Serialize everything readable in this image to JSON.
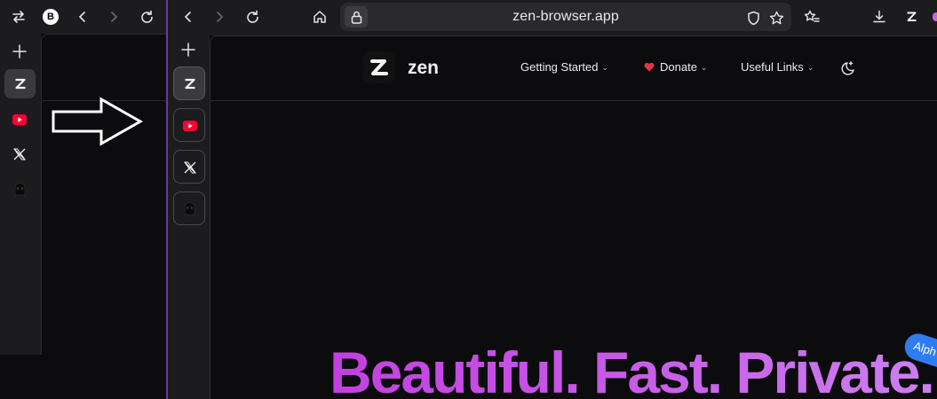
{
  "left_window": {
    "toolbar": {
      "sidebar_toggle_icon": "swap-arrows-icon",
      "profile_badge": "B",
      "back_icon": "chevron-left-icon",
      "forward_icon": "chevron-right-icon",
      "reload_icon": "reload-icon"
    },
    "sidebar": {
      "new_tab_icon": "plus-icon",
      "tabs": [
        {
          "name": "zen",
          "icon": "zen-logo-icon"
        },
        {
          "name": "youtube",
          "icon": "youtube-icon"
        },
        {
          "name": "x",
          "icon": "x-logo-icon"
        },
        {
          "name": "other",
          "icon": "mascot-icon"
        }
      ]
    }
  },
  "arrow": {
    "icon": "right-arrow-icon"
  },
  "right_window": {
    "toolbar": {
      "back_icon": "chevron-left-icon",
      "forward_icon": "chevron-right-icon",
      "reload_icon": "reload-icon",
      "home_icon": "home-icon",
      "url": "zen-browser.app",
      "shield_icon": "shield-icon",
      "bookmark_icon": "star-icon",
      "bookmarks_list_icon": "star-list-icon",
      "downloads_icon": "download-icon",
      "zen_menu_icon": "zen-logo-icon",
      "extension_icon": "extension-dot-icon"
    },
    "sidebar": {
      "new_tab_icon": "plus-icon",
      "essentials": [
        {
          "name": "zen",
          "icon": "zen-logo-icon",
          "active": true
        },
        {
          "name": "youtube",
          "icon": "youtube-icon",
          "active": false
        },
        {
          "name": "x",
          "icon": "x-logo-icon",
          "active": false
        },
        {
          "name": "other",
          "icon": "mascot-icon",
          "active": false
        }
      ]
    },
    "site": {
      "brand": "zen",
      "nav": [
        {
          "label": "Getting Started",
          "has_dropdown": true
        },
        {
          "label": "Donate",
          "has_dropdown": true,
          "icon": "heart-icon"
        },
        {
          "label": "Useful Links",
          "has_dropdown": true
        }
      ],
      "theme_toggle_icon": "moon-stars-icon",
      "hero_title": "Beautiful. Fast. Private.",
      "badge": "Alph"
    }
  },
  "colors": {
    "background": "#0c0b0d",
    "chrome": "#1c1b1e",
    "divider": "#5b3fa6",
    "hero_gradient_start": "#c240e0",
    "hero_gradient_end": "#cc7ff0",
    "badge": "#2f7cf0",
    "heart": "#e8344a",
    "youtube": "#ff0033"
  }
}
